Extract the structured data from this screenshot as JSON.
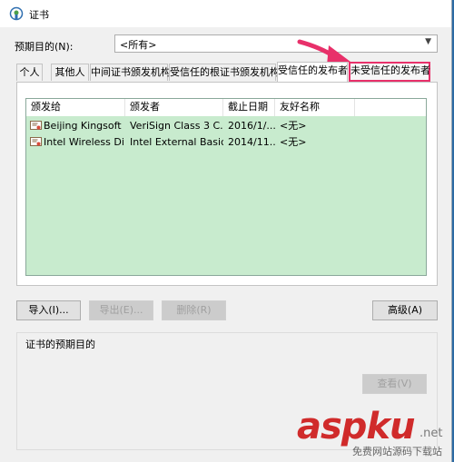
{
  "window": {
    "title": "证书",
    "icon": "certificate-icon"
  },
  "purpose": {
    "label": "预期目的(N):",
    "value": "<所有>"
  },
  "tabs": [
    {
      "label": "个人"
    },
    {
      "label": "其他人"
    },
    {
      "label": "中间证书颁发机构"
    },
    {
      "label": "受信任的根证书颁发机构"
    },
    {
      "label": "受信任的发布者"
    },
    {
      "label": "未受信任的发布者"
    }
  ],
  "list": {
    "columns": [
      "颁发给",
      "颁发者",
      "截止日期",
      "友好名称"
    ],
    "rows": [
      [
        "Beijing Kingsoft ...",
        "VeriSign Class 3 C...",
        "2016/1/...",
        "<无>"
      ],
      [
        "Intel Wireless Di...",
        "Intel External Basic...",
        "2014/11...",
        "<无>"
      ]
    ]
  },
  "buttons": {
    "import": "导入(I)...",
    "export": "导出(E)...",
    "remove": "删除(R)",
    "advanced": "高级(A)",
    "view": "查看(V)"
  },
  "group": {
    "label": "证书的预期目的"
  },
  "watermark": {
    "brand": "aspku",
    "net": ".net",
    "tagline": "免费网站源码下载站"
  },
  "colors": {
    "list_background": "#c8ebce",
    "highlight_border": "#e8306a",
    "arrow": "#e8306a",
    "watermark": "#d02b2b",
    "desktop": "#2b6aa3"
  }
}
